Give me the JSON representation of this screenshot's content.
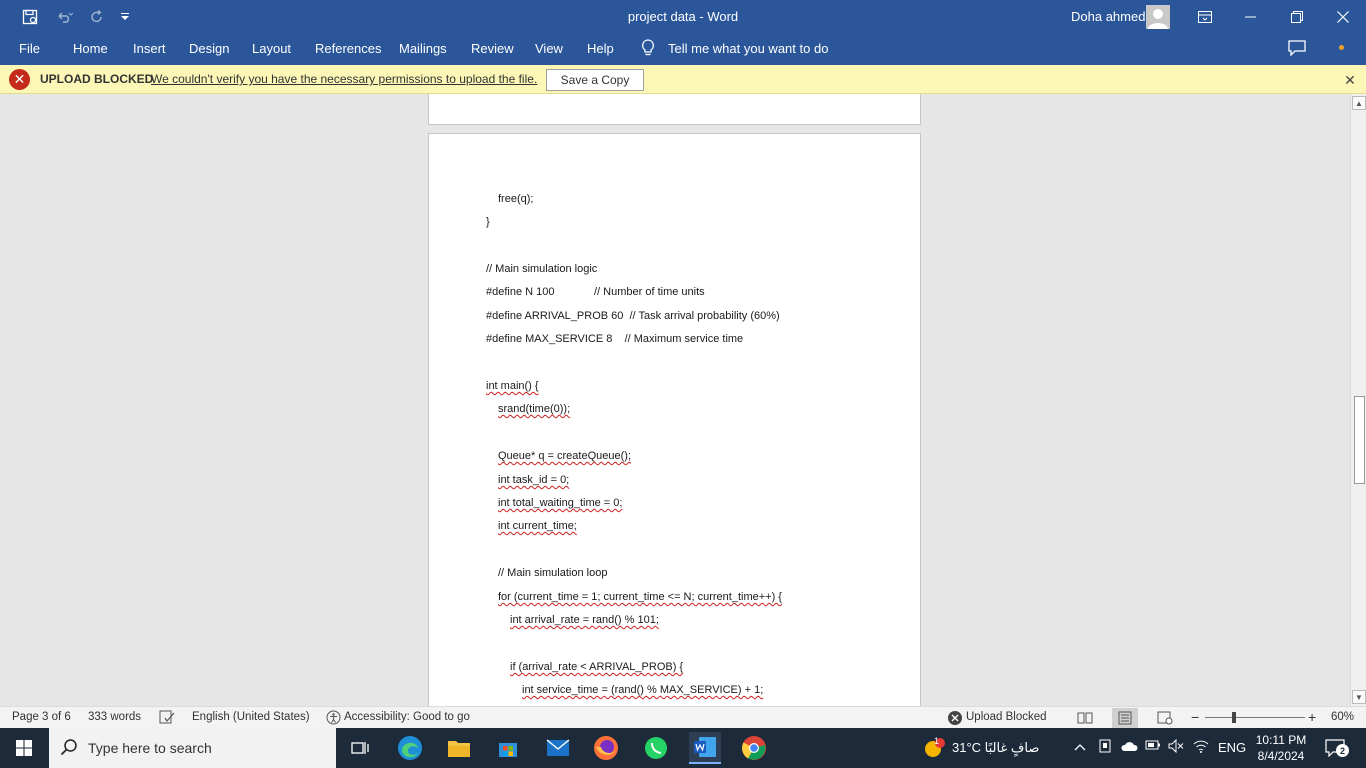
{
  "window": {
    "title": "project data  -  Word",
    "user_name": "Doha ahmed"
  },
  "ribbon": {
    "tabs": [
      "File",
      "Home",
      "Insert",
      "Design",
      "Layout",
      "References",
      "Mailings",
      "Review",
      "View",
      "Help"
    ],
    "tell_me": "Tell me what you want to do"
  },
  "message_bar": {
    "label": "UPLOAD BLOCKED",
    "message": "We couldn't verify you have the necessary permissions to upload the file.",
    "button": "Save a Copy"
  },
  "document": {
    "lines": [
      "free(q);",
      "}",
      "// Main simulation logic",
      "#define N 100",
      "// Number of time units",
      "#define ARRIVAL_PROB 60  // Task arrival probability (60%)",
      "#define MAX_SERVICE 8    // Maximum service time",
      "int main() {",
      "srand(time(0));",
      "Queue* q = createQueue();",
      "int task_id = 0;",
      "int total_waiting_time = 0;",
      "int current_time;",
      "// Main simulation loop",
      "for (current_time = 1; current_time <= N; current_time++) {",
      "int arrival_rate = rand() % 101;",
      "if (arrival_rate < ARRIVAL_PROB) {",
      "int service_time = (rand() % MAX_SERVICE) + 1;"
    ]
  },
  "status_bar": {
    "page": "Page 3 of 6",
    "words": "333 words",
    "language": "English (United States)",
    "accessibility": "Accessibility: Good to go",
    "upload": "Upload Blocked",
    "zoom": "60%"
  },
  "taskbar": {
    "search_placeholder": "Type here to search",
    "weather": "31°C  صافٍ غالبًا",
    "language": "ENG",
    "time": "10:11 PM",
    "date": "8/4/2024",
    "notifications": "2",
    "weather_badge": "1"
  },
  "colors": {
    "word_blue": "#2b579a",
    "message_yellow": "#fcf7b6",
    "error_red": "#c42b1c",
    "taskbar": "#1c2a3a"
  }
}
